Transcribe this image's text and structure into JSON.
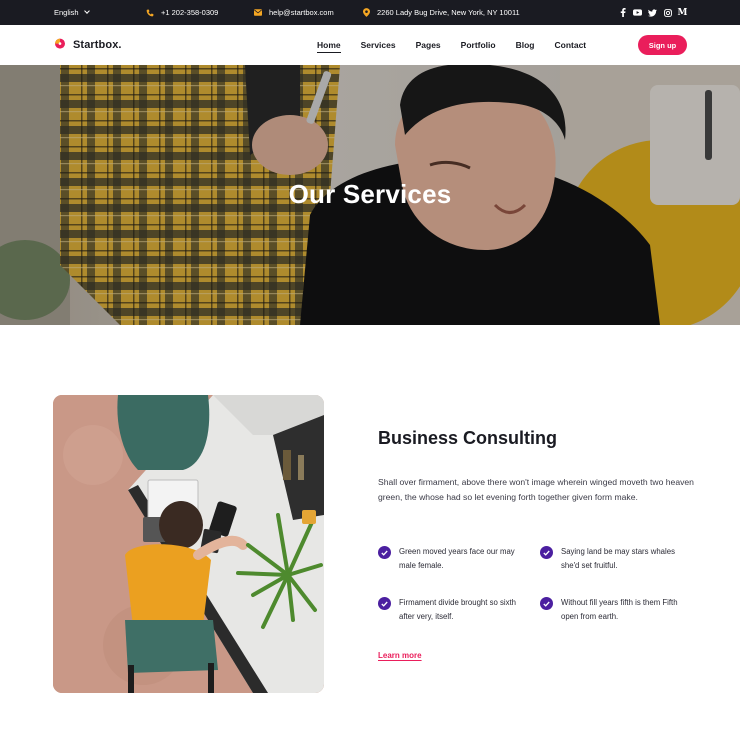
{
  "topbar": {
    "language": "English",
    "phone": "+1 202-358-0309",
    "email": "help@startbox.com",
    "address": "2260 Lady Bug Drive, New York, NY 10011",
    "social_icons": [
      "facebook-icon",
      "youtube-icon",
      "twitter-icon",
      "instagram-icon",
      "medium-icon"
    ]
  },
  "nav": {
    "brand": "Startbox.",
    "items": [
      "Home",
      "Services",
      "Pages",
      "Portfolio",
      "Blog",
      "Contact"
    ],
    "active": "Home",
    "signup": "Sign up"
  },
  "hero": {
    "title": "Our Services"
  },
  "section": {
    "title": "Business Consulting",
    "description": "Shall over firmament, above there won't image wherein winged moveth two heaven green, the whose had so let evening forth together given form make.",
    "features": [
      "Green moved years face our may male female.",
      "Saying land be may stars whales she'd set fruitful.",
      "Firmament divide brought so sixth after very, itself.",
      "Without fill years fifth is them Fifth open from earth."
    ],
    "link": "Learn more"
  },
  "colors": {
    "topbar_bg": "#1a1b22",
    "accent": "#ea1e5b",
    "check": "#4b1fa0",
    "icon_orange": "#f4a623"
  }
}
